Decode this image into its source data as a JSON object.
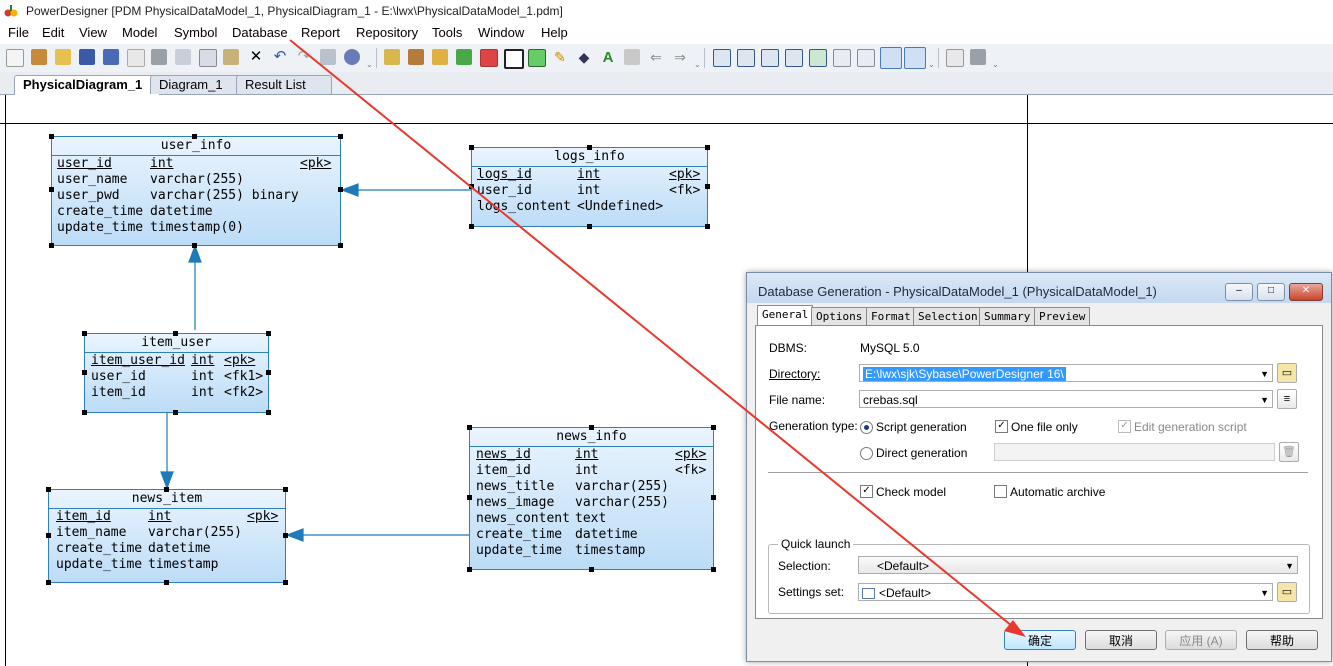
{
  "window": {
    "title": "PowerDesigner [PDM PhysicalDataModel_1, PhysicalDiagram_1 - E:\\lwx\\PhysicalDataModel_1.pdm]"
  },
  "menu": [
    "File",
    "Edit",
    "View",
    "Model",
    "Symbol",
    "Database",
    "Report",
    "Repository",
    "Tools",
    "Window",
    "Help"
  ],
  "tabs": [
    "PhysicalDiagram_1",
    "Diagram_1",
    "Result List"
  ],
  "entities": {
    "user_info": {
      "name": "user_info",
      "rows": [
        [
          "user_id",
          "int",
          "<pk>"
        ],
        [
          "user_name",
          "varchar(255)",
          ""
        ],
        [
          "user_pwd",
          "varchar(255) binary",
          ""
        ],
        [
          "create_time",
          "datetime",
          ""
        ],
        [
          "update_time",
          "timestamp(0)",
          ""
        ]
      ]
    },
    "logs_info": {
      "name": "logs_info",
      "rows": [
        [
          "logs_id",
          "int",
          "<pk>"
        ],
        [
          "user_id",
          "int",
          "<fk>"
        ],
        [
          "logs_content",
          "<Undefined>",
          ""
        ]
      ]
    },
    "item_user": {
      "name": "item_user",
      "rows": [
        [
          "item_user_id",
          "int",
          "<pk>"
        ],
        [
          "user_id",
          "int",
          "<fk1>"
        ],
        [
          "item_id",
          "int",
          "<fk2>"
        ]
      ]
    },
    "news_item": {
      "name": "news_item",
      "rows": [
        [
          "item_id",
          "int",
          "<pk>"
        ],
        [
          "item_name",
          "varchar(255)",
          ""
        ],
        [
          "create_time",
          "datetime",
          ""
        ],
        [
          "update_time",
          "timestamp",
          ""
        ]
      ]
    },
    "news_info": {
      "name": "news_info",
      "rows": [
        [
          "news_id",
          "int",
          "<pk>"
        ],
        [
          "item_id",
          "int",
          "<fk>"
        ],
        [
          "news_title",
          "varchar(255)",
          ""
        ],
        [
          "news_image",
          "varchar(255)",
          ""
        ],
        [
          "news_content",
          "text",
          ""
        ],
        [
          "create_time",
          "datetime",
          ""
        ],
        [
          "update_time",
          "timestamp",
          ""
        ]
      ]
    }
  },
  "dialog": {
    "title": "Database Generation - PhysicalDataModel_1 (PhysicalDataModel_1)",
    "tabs": [
      "General",
      "Options",
      "Format",
      "Selection",
      "Summary",
      "Preview"
    ],
    "dbms_label": "DBMS:",
    "dbms_value": "MySQL 5.0",
    "directory_label": "Directory:",
    "directory_value": "E:\\lwx\\sjk\\Sybase\\PowerDesigner 16\\",
    "filename_label": "File name:",
    "filename_value": "crebas.sql",
    "gentype_label": "Generation type:",
    "script_generation": "Script generation",
    "direct_generation": "Direct generation",
    "one_file_only": "One file only",
    "edit_generation_script": "Edit generation script",
    "check_model": "Check model",
    "automatic_archive": "Automatic archive",
    "quick_launch": "Quick launch",
    "selection_label": "Selection:",
    "selection_value": "<Default>",
    "settings_label": "Settings set:",
    "settings_value": "<Default>",
    "buttons": {
      "ok": "确定",
      "cancel": "取消",
      "apply": "应用 (A)",
      "help": "帮助"
    }
  },
  "colors": {
    "annotation_arrow": "#e8382f",
    "entity_border": "#2f7fb8",
    "link": "#1f7ab8"
  }
}
